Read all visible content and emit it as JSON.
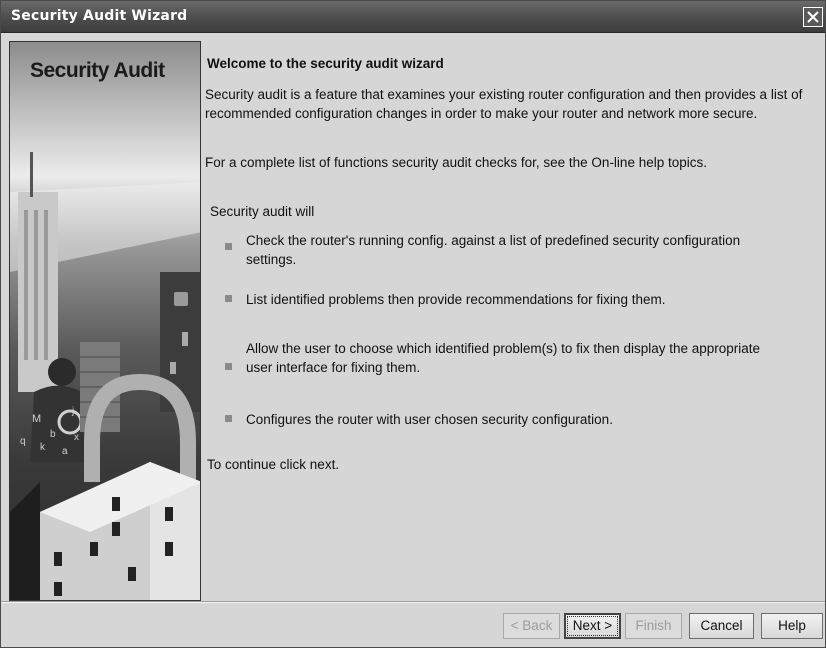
{
  "window": {
    "title": "Security Audit Wizard"
  },
  "side_panel": {
    "title": "Security Audit",
    "art_letters": [
      "M",
      "b",
      "j",
      "k",
      "x",
      "q",
      "a"
    ]
  },
  "content": {
    "heading": "Welcome to the security audit wizard",
    "intro": "Security audit is a feature that examines your existing router configuration and then provides a list of recommended configuration changes in order to make your router and network more secure.",
    "help_note": "For a complete list of functions security audit checks for, see the On-line help topics.",
    "list_intro": "Security audit will",
    "bullets": [
      "Check the router's running config. against a list of predefined security configuration settings.",
      "List identified problems then provide recommendations for fixing them.",
      "Allow the user to choose which identified problem(s) to fix then display the appropriate user interface for fixing them.",
      "Configures the router with user chosen security configuration."
    ],
    "continue": "To continue click next."
  },
  "buttons": {
    "back": "< Back",
    "next": "Next >",
    "finish": "Finish",
    "cancel": "Cancel",
    "help": "Help"
  },
  "colors": {
    "titlebar": "#4f4f4f",
    "dialog_bg": "#d6d6d6",
    "disabled_text": "#9c9c9c"
  }
}
